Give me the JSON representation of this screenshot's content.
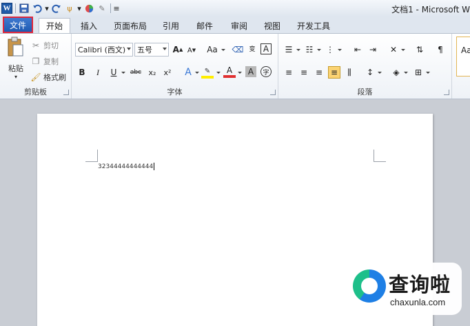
{
  "window": {
    "title": "文档1 - Microsoft W"
  },
  "qat": {
    "app_icon": "W"
  },
  "tabs": [
    {
      "label": "文件"
    },
    {
      "label": "开始"
    },
    {
      "label": "插入"
    },
    {
      "label": "页面布局"
    },
    {
      "label": "引用"
    },
    {
      "label": "邮件"
    },
    {
      "label": "审阅"
    },
    {
      "label": "视图"
    },
    {
      "label": "开发工具"
    }
  ],
  "clipboard": {
    "paste": "粘贴",
    "cut": "剪切",
    "copy": "复制",
    "format_painter": "格式刷",
    "label": "剪贴板"
  },
  "font": {
    "family": "Calibri (西文)",
    "size": "五号",
    "label": "字体",
    "grow": "A",
    "shrink": "A",
    "case": "Aa",
    "bold": "B",
    "italic": "I",
    "underline": "U",
    "strike": "abc",
    "subscript": "x₂",
    "superscript": "x²",
    "effects": "A",
    "font_color": "A",
    "shading": "A",
    "char_border": "A",
    "phonetic": "wén",
    "enclose": "字",
    "clear": "变"
  },
  "paragraph": {
    "label": "段落"
  },
  "styles": {
    "preview": "Aa"
  },
  "document": {
    "text": "32344444444444"
  },
  "watermark": {
    "cn": "查询啦",
    "en": "chaxunla.com"
  }
}
